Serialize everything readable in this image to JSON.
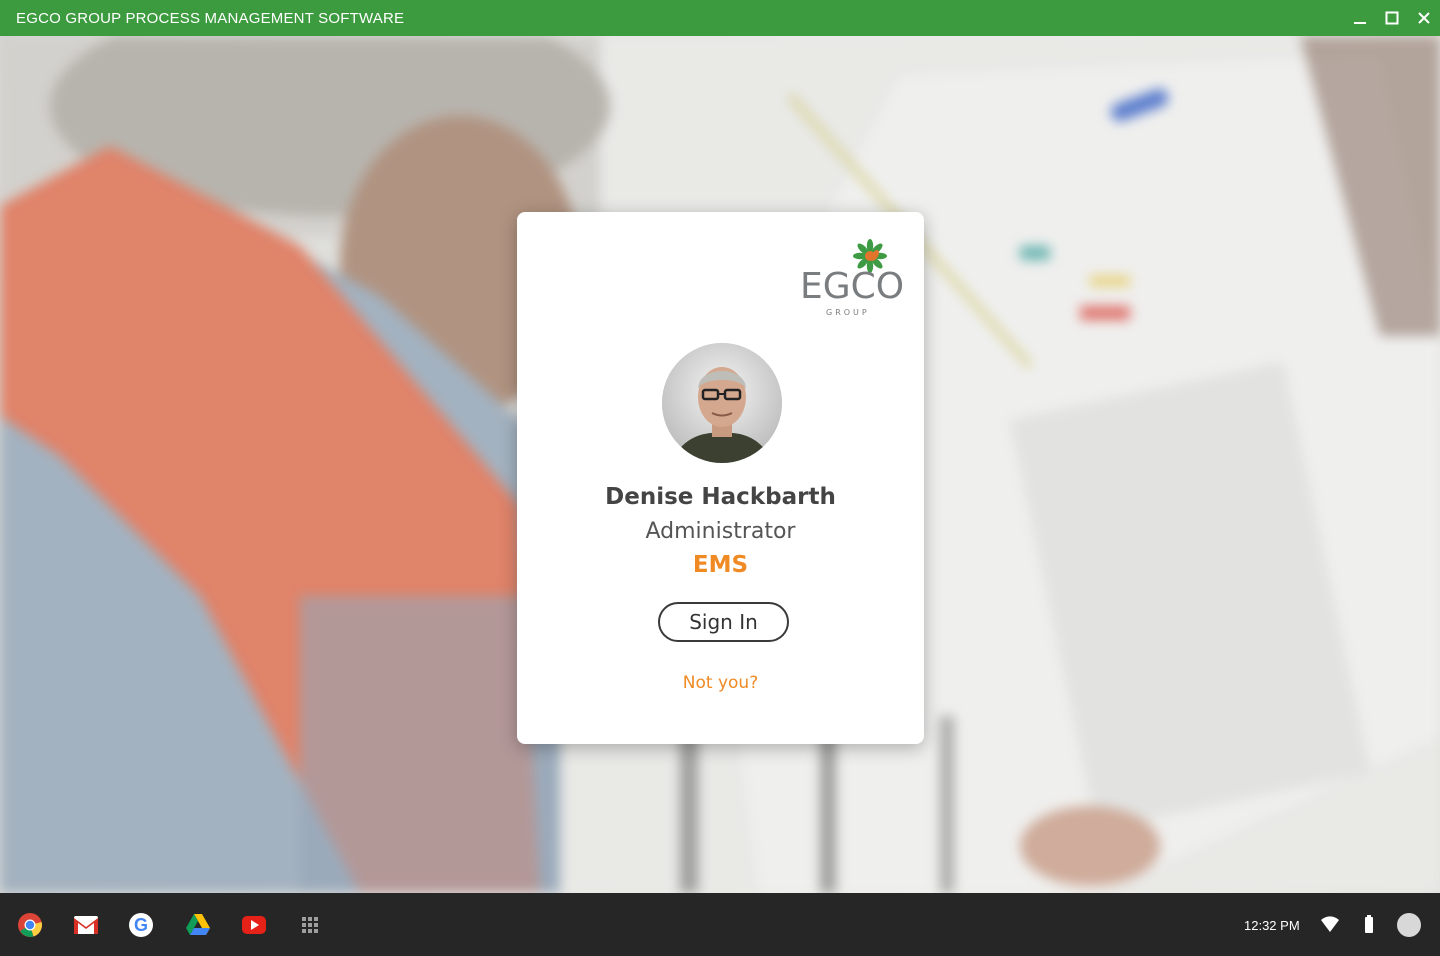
{
  "window": {
    "title": "EGCO GROUP PROCESS MANAGEMENT SOFTWARE",
    "controls": [
      "minimize-icon",
      "maximize-icon",
      "close-icon"
    ],
    "titlebar_color": "#3d9b3f"
  },
  "card": {
    "logo": {
      "word": "EGCO",
      "sub": "GROUP"
    },
    "user": {
      "name": "Denise Hackbarth",
      "role": "Administrator",
      "org": "EMS"
    },
    "signin_label": "Sign In",
    "not_you_label": "Not you?",
    "accent_color": "#f08a24"
  },
  "shelf": {
    "apps": [
      {
        "name": "chrome-icon"
      },
      {
        "name": "gmail-icon"
      },
      {
        "name": "google-icon"
      },
      {
        "name": "drive-icon"
      },
      {
        "name": "youtube-icon"
      },
      {
        "name": "app-launcher-icon"
      }
    ],
    "clock": "12:32 PM",
    "tray": [
      "wifi-icon",
      "battery-icon",
      "account-avatar"
    ]
  }
}
